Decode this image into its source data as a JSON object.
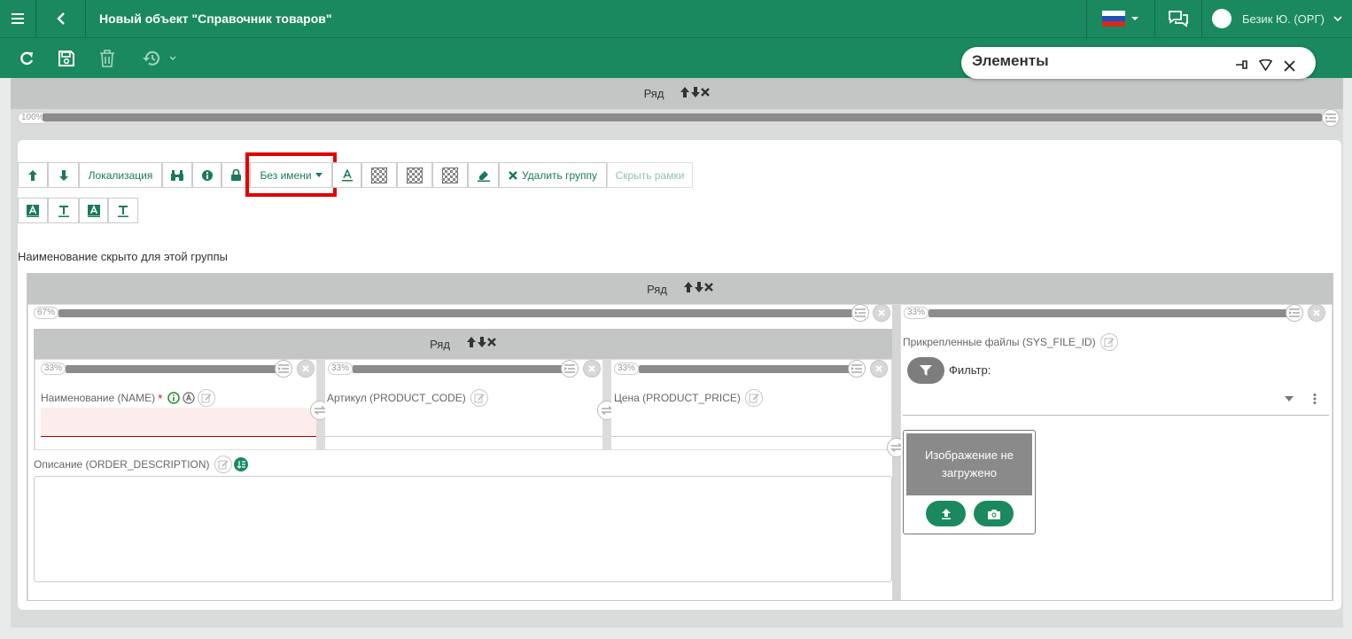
{
  "header": {
    "menu_icon": "hamburger-icon",
    "back_icon": "chevron-left-icon",
    "title": "Новый объект \"Справочник товаров\"",
    "flag_icon": "russia-flag-icon",
    "chat_icon": "chat-icon",
    "user_name": "Безик Ю. (ОРГ)"
  },
  "toolbar": {
    "icons": [
      "refresh-icon",
      "save-icon",
      "delete-icon",
      "history-icon"
    ]
  },
  "elements_panel": {
    "title": "Элементы"
  },
  "outer_row": {
    "label": "Ряд",
    "arrows": "🡅🡇✖",
    "width_pct": "100%"
  },
  "group_toolbar": {
    "localization": "Локализация",
    "name_dropdown": "Без имени",
    "delete_group": "Удалить группу",
    "hide_frames": "Скрыть рамки"
  },
  "group": {
    "hidden_name_note": "Наименование скрыто для этой группы"
  },
  "inner_row": {
    "label": "Ряд",
    "left_pct": "67%",
    "right_pct": "33%"
  },
  "nested_row": {
    "label": "Ряд",
    "col_pcts": [
      "33%",
      "33%",
      "33%"
    ]
  },
  "fields": {
    "name_label": "Наименование (NAME)",
    "required_mark": "*",
    "article_label": "Артикул (PRODUCT_CODE)",
    "price_label": "Цена (PRODUCT_PRICE)",
    "description_label": "Описание (ORDER_DESCRIPTION)"
  },
  "files": {
    "label": "Прикрепленные файлы (SYS_FILE_ID)",
    "filter_label": "Фильтр:",
    "image_placeholder": "Изображение не загружено"
  },
  "colors": {
    "brand_green": "#1a8a5e",
    "highlight_red": "#e00000"
  }
}
